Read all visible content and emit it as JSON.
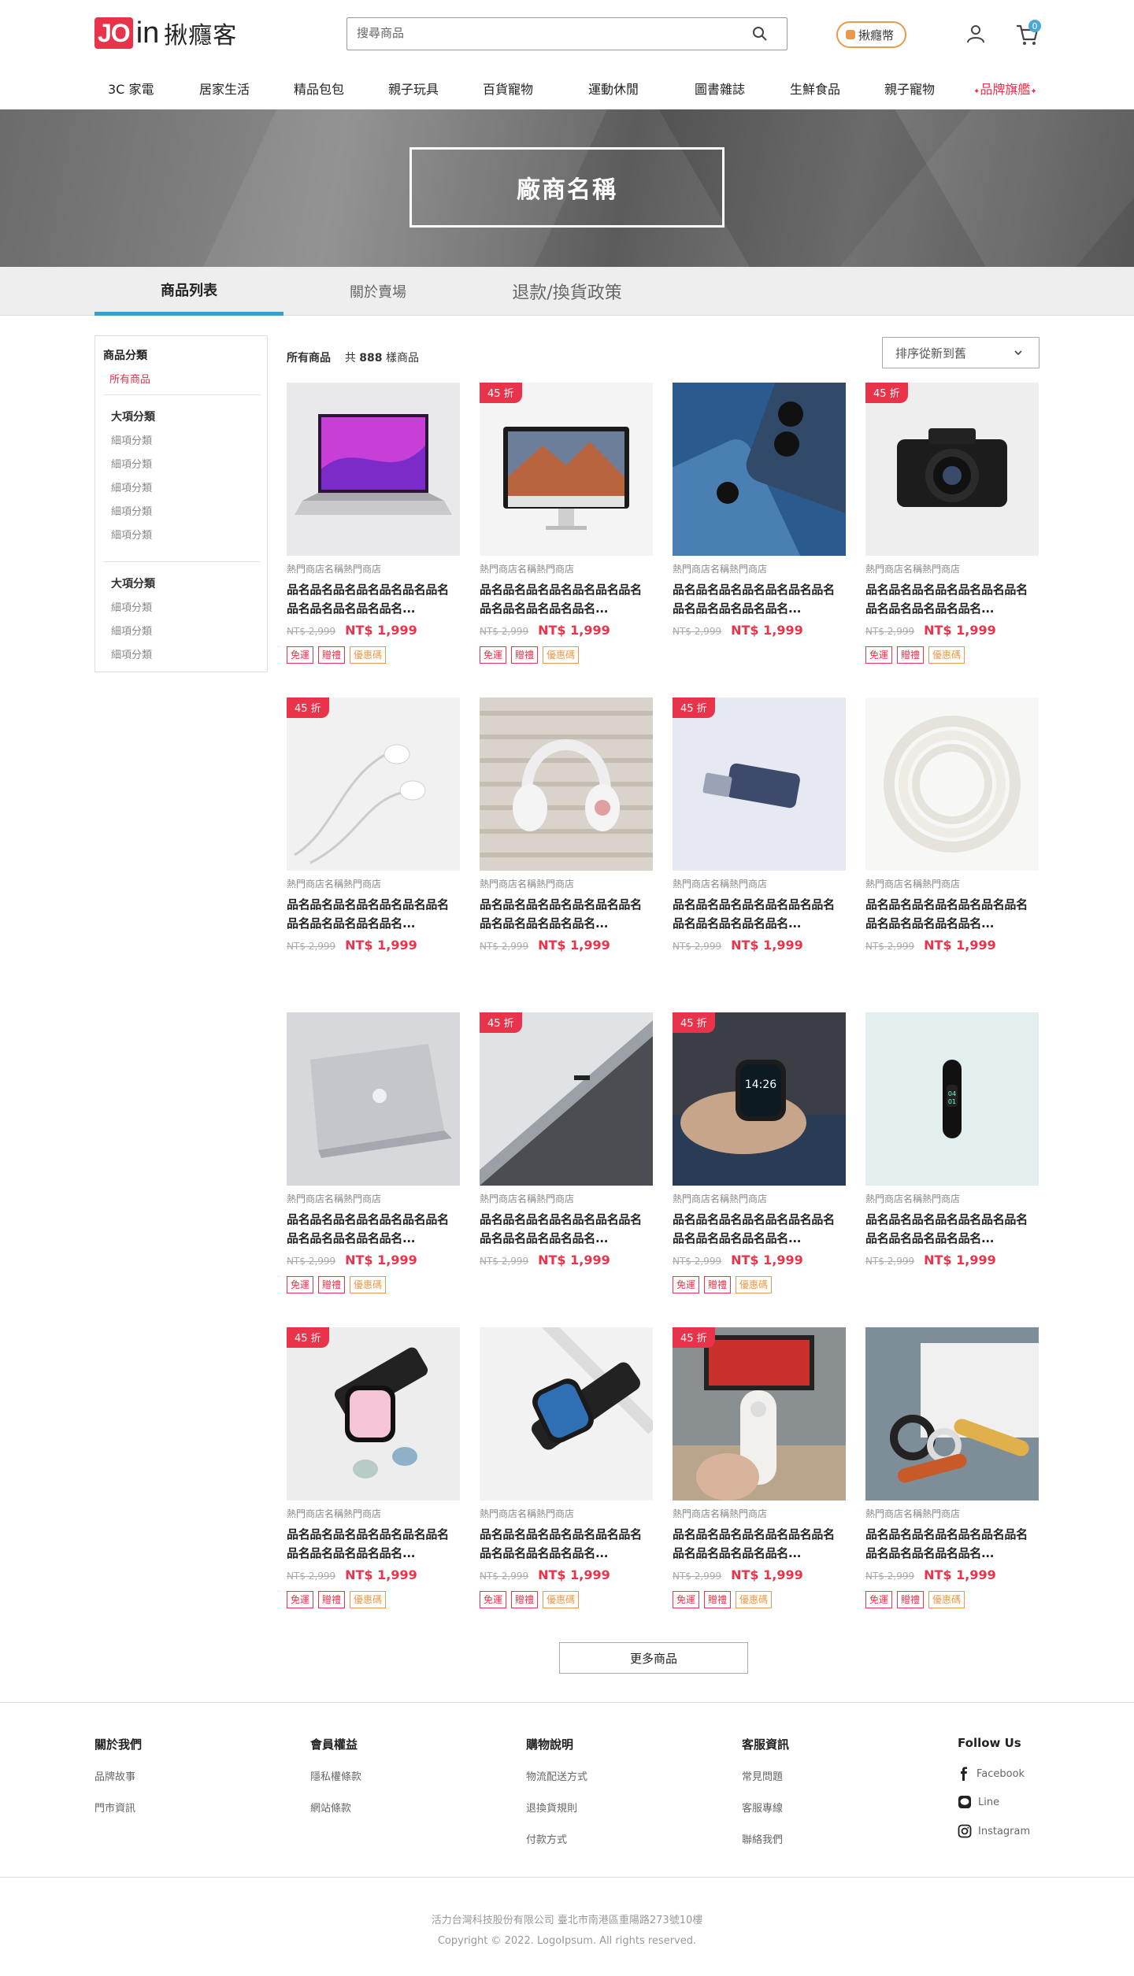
{
  "header": {
    "logo_box": "JO",
    "logo_in": "in",
    "logo_cn": "揪癮客",
    "search_placeholder": "搜尋商品",
    "badge_label": "揪癮幣",
    "cart_count": "0"
  },
  "categories": [
    "3C 家電",
    "居家生活",
    "精品包包",
    "親子玩具",
    "百貨寵物",
    "運動休閒",
    "圖書雜誌",
    "生鮮食品",
    "親子寵物",
    "品牌旗艦"
  ],
  "banner": {
    "title": "廠商名稱"
  },
  "tabs": [
    "商品列表",
    "關於賣場",
    "退款/換貨政策"
  ],
  "sidebar": {
    "title": "商品分類",
    "all": "所有商品",
    "groups": [
      {
        "name": "大項分類",
        "items": [
          "細項分類",
          "細項分類",
          "細項分類",
          "細項分類",
          "細項分類"
        ]
      },
      {
        "name": "大項分類",
        "items": [
          "細項分類",
          "細項分類",
          "細項分類"
        ]
      }
    ]
  },
  "list": {
    "breadcrumb": "所有商品",
    "count_prefix": "共",
    "count": "888",
    "count_suffix": "樣商品",
    "sort_label": "排序從新到舊"
  },
  "product_common": {
    "shop": "熱門商店名稱熱門商店",
    "orig_price": "NT$ 2,999",
    "sale_price": "NT$ 1,999",
    "tag_ship": "免運",
    "tag_gift": "贈禮",
    "tag_coupon": "優惠碼"
  },
  "products": [
    {
      "discount": "",
      "name": "品名品名品名品名品名品名品名品名品名品名品名品名...",
      "tags": true,
      "image": "laptop-icon"
    },
    {
      "discount": "45 折",
      "name": "品名品名品名品名品名品名品名品名品名品名品名品名...",
      "tags": true,
      "image": "imac-icon"
    },
    {
      "discount": "",
      "name": "品名品名品名品名品名品名品名品名品名品名品名品名...",
      "tags": false,
      "image": "phone-icon"
    },
    {
      "discount": "45 折",
      "name": "品名品名品名品名品名品名品名品名品名品名品名品名...",
      "tags": true,
      "image": "camera-icon"
    },
    {
      "discount": "45 折",
      "name": "品名品名品名品名品名品名品名品名品名品名品名品名...",
      "tags": false,
      "image": "earphones-icon"
    },
    {
      "discount": "",
      "name": "品名品名品名品名品名品名品名品名品名品名品名品名...",
      "tags": false,
      "image": "headphones-icon"
    },
    {
      "discount": "45 折",
      "name": "品名品名品名品名品名品名品名品名品名品名品名品名...",
      "tags": false,
      "image": "usb-adapter-icon"
    },
    {
      "discount": "",
      "name": "品名品名品名品名品名品名品名品名品名品名品名品名...",
      "tags": false,
      "image": "cable-icon"
    },
    {
      "discount": "",
      "name": "品名品名品名品名品名品名品名品名品名品名品名品名...",
      "tags": true,
      "image": "macbook-icon"
    },
    {
      "discount": "45 折",
      "name": "品名品名品名品名品名品名品名品名品名品名品名品名...",
      "tags": false,
      "image": "tablet-icon"
    },
    {
      "discount": "45 折",
      "name": "品名品名品名品名品名品名品名品名品名品名品名品名...",
      "tags": true,
      "image": "smartwatch-icon"
    },
    {
      "discount": "",
      "name": "品名品名品名品名品名品名品名品名品名品名品名品名...",
      "tags": false,
      "image": "fitness-band-icon"
    },
    {
      "discount": "45 折",
      "name": "品名品名品名品名品名品名品名品名品名品名品名品名...",
      "tags": true,
      "image": "applewatch-icon"
    },
    {
      "discount": "",
      "name": "品名品名品名品名品名品名品名品名品名品名品名品名...",
      "tags": true,
      "image": "watch-band-icon"
    },
    {
      "discount": "45 折",
      "name": "品名品名品名品名品名品名品名品名品名品名品名品名...",
      "tags": true,
      "image": "remote-icon"
    },
    {
      "discount": "",
      "name": "品名品名品名品名品名品名品名品名品名品名品名品名...",
      "tags": true,
      "image": "airtag-icon"
    }
  ],
  "more_button": "更多商品",
  "footer": {
    "cols": [
      {
        "title": "關於我們",
        "links": [
          "品牌故事",
          "門市資訊"
        ]
      },
      {
        "title": "會員權益",
        "links": [
          "隱私權條款",
          "網站條款"
        ]
      },
      {
        "title": "購物說明",
        "links": [
          "物流配送方式",
          "退換貨規則",
          "付款方式"
        ]
      },
      {
        "title": "客服資訊",
        "links": [
          "常見問題",
          "客服專線",
          "聯絡我們"
        ]
      }
    ],
    "follow_title": "Follow Us",
    "social": [
      "Facebook",
      "Line",
      "Instagram"
    ],
    "company": "活力台灣科技股份有限公司  臺北市南港區重陽路273號10樓",
    "copyright": "Copyright © 2022. LogoIpsum. All rights reserved."
  },
  "colors": {
    "accent": "#e8334a",
    "tab_active": "#3a9fc6",
    "coupon": "#e89a4c",
    "cart_badge": "#4aa8d8"
  }
}
